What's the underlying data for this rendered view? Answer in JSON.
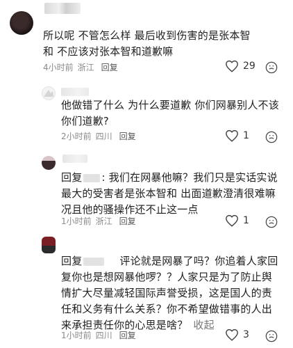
{
  "comments": [
    {
      "text": "所以呢 不管怎么样 最后收到伤害的是张本智和 不应该对张本智和道歉嘛",
      "time": "4小时前",
      "location": "浙江",
      "reply_label": "回复",
      "likes": "29"
    },
    {
      "text": "他做错了什么 为什么要道歉 你们网暴别人不该你们道歉?",
      "time": "2小时前",
      "location": "四川",
      "reply_label": "回复",
      "likes": "1"
    },
    {
      "prefix": "回复",
      "text": ": 我们在网暴他嘛？我们只是实话实说 最大的受害者是张本智和 出面道歉澄清很难嘛 况且他的骚操作还不止这一点",
      "time": "1小时前",
      "location": "浙江",
      "reply_label": "回复",
      "likes": "1"
    },
    {
      "prefix": "回复",
      "text": "评论就是网暴了吗？你追着人家回复你也是想网暴他啰？？人家只是为了防止舆情扩大尽量减轻国际声誉受损，这是国人的责任和义务有什么关系？你不希望做错事的人出来承担责任你的心思是啥？",
      "collapse": "收起",
      "time": "1小时前",
      "location": "四川",
      "reply_label": "回复",
      "likes": "3"
    }
  ]
}
